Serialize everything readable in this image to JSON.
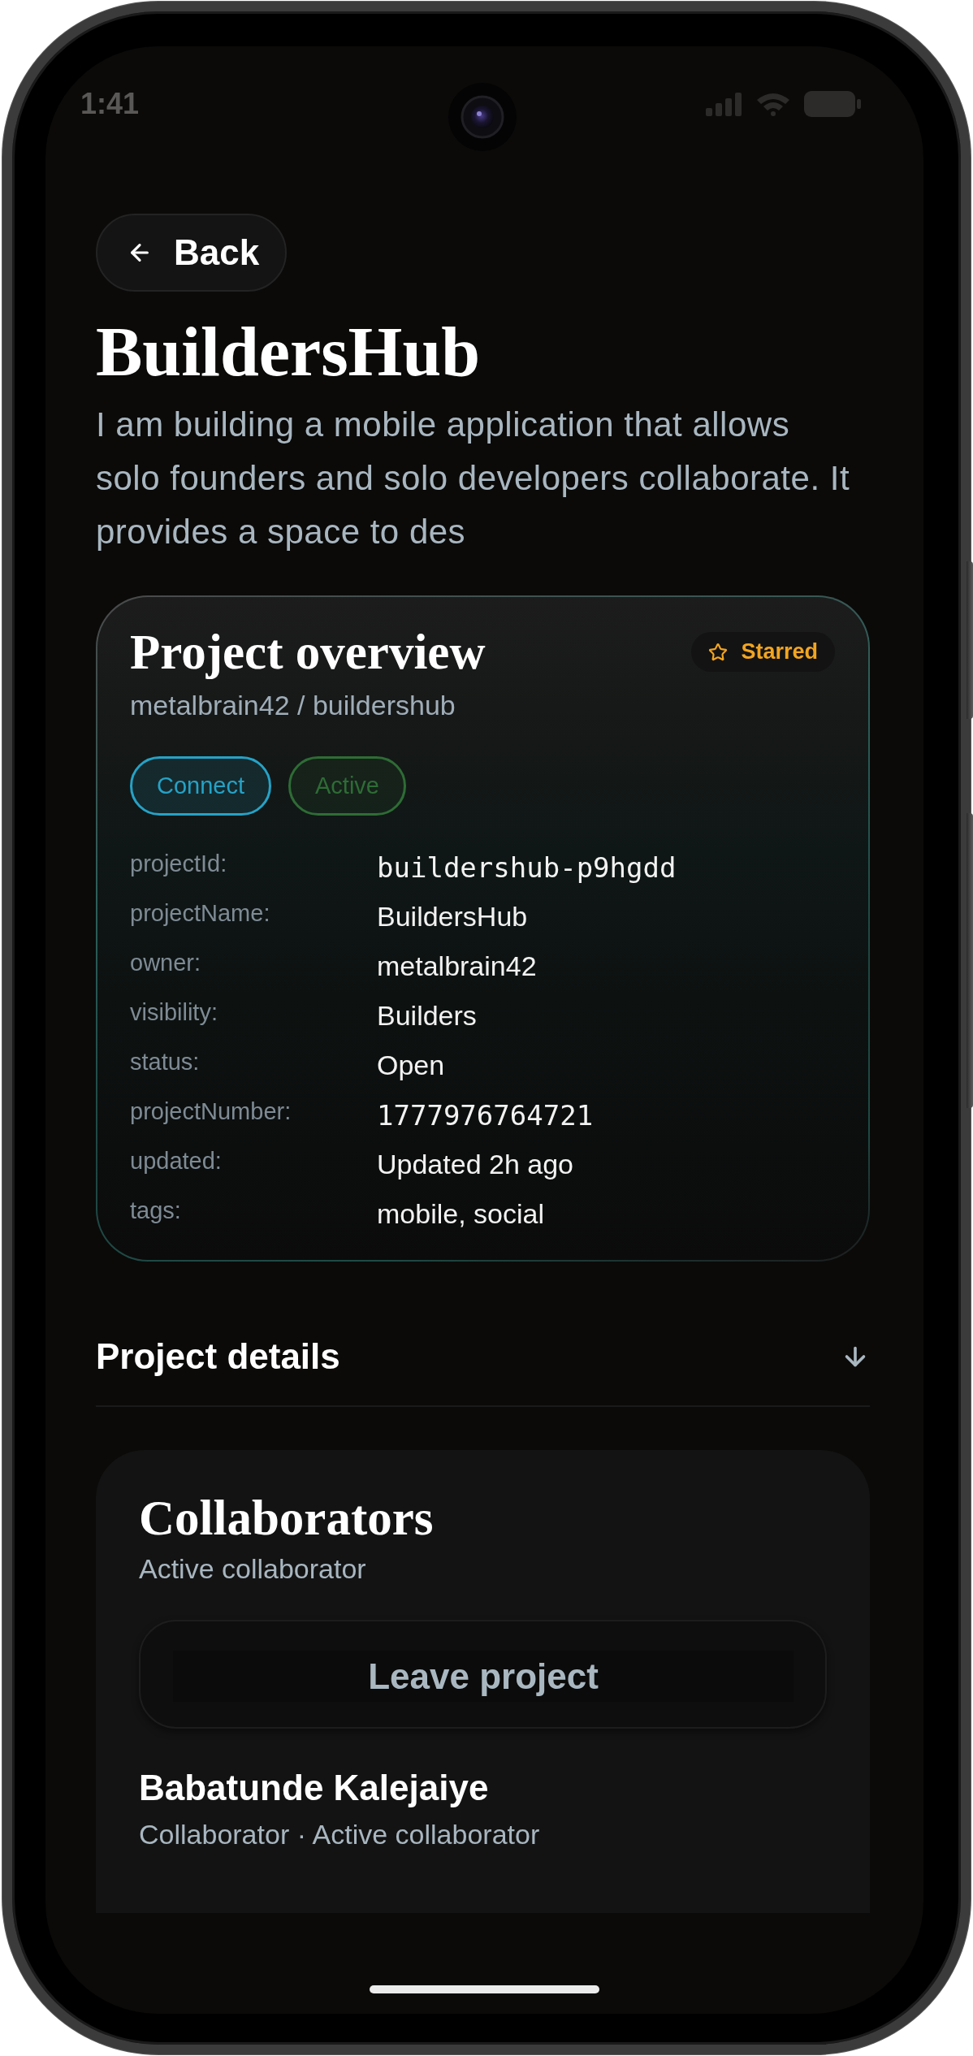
{
  "status_bar": {
    "time": "1:41"
  },
  "back_button": {
    "label": "Back"
  },
  "project": {
    "title": "BuildersHub",
    "description": "I am building a mobile application that allows solo founders and solo developers collaborate. It provides a space to des"
  },
  "overview_card": {
    "title": "Project overview",
    "badge": "Starred",
    "path": "metalbrain42 / buildershub",
    "chips": [
      {
        "label": "Connect",
        "color": "#26a2c6"
      },
      {
        "label": "Active",
        "color": "#2e6c35"
      }
    ],
    "fields": [
      {
        "key": "projectId:",
        "value": "buildershub-p9hgdd",
        "kind": "mono"
      },
      {
        "key": "projectName:",
        "value": "BuildersHub",
        "kind": "text"
      },
      {
        "key": "owner:",
        "value": "metalbrain42",
        "kind": "text"
      },
      {
        "key": "visibility:",
        "value": "Builders",
        "kind": "text"
      },
      {
        "key": "status:",
        "value": "Open",
        "kind": "text"
      },
      {
        "key": "projectNumber:",
        "value": "1777976764721",
        "kind": "mono"
      },
      {
        "key": "updated:",
        "value": "Updated 2h ago",
        "kind": "text"
      },
      {
        "key": "tags:",
        "value": "mobile, social",
        "kind": "text"
      }
    ]
  },
  "details_section": {
    "title": "Project details"
  },
  "collaborators_card": {
    "title": "Collaborators",
    "subtitle": "Active collaborator",
    "leave_button": "Leave project",
    "members": [
      {
        "name": "Babatunde Kalejaiye",
        "role": "Collaborator · Active collaborator"
      }
    ]
  }
}
